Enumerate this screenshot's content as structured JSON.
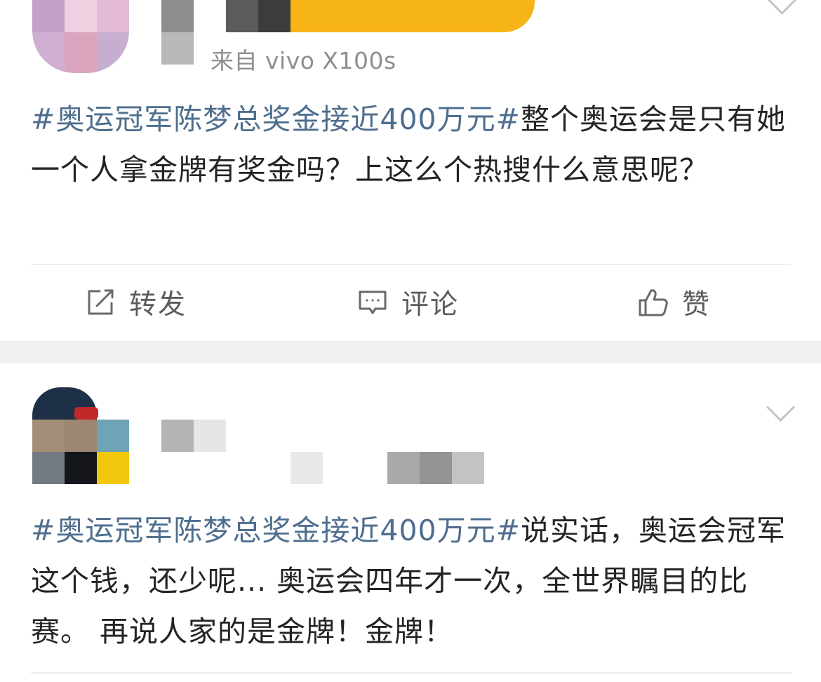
{
  "posts": [
    {
      "source": "来自 vivo X100s",
      "hashtag": "#奥运冠军陈梦总奖金接近400万元#",
      "text": "整个奥运会是只有她一个人拿金牌有奖金吗？上这么个热搜什么意思呢？"
    },
    {
      "hashtag": "#奥运冠军陈梦总奖金接近400万元#",
      "text": "说实话，奥运会冠军这个钱，还少呢... 奥运会四年才一次，全世界瞩目的比赛。 再说人家的是金牌！金牌！"
    }
  ],
  "actions": {
    "repost": "转发",
    "comment": "评论",
    "like": "赞"
  },
  "icons": {
    "repost": "repost-icon",
    "comment": "comment-icon",
    "like": "thumbs-up-icon",
    "menu": "chevron-down-icon"
  },
  "colors": {
    "hashtag": "#4e6e8e",
    "text": "#242424",
    "meta": "#8f8f8f",
    "action": "#5c5c5c",
    "separator": "#f1f1f1"
  }
}
